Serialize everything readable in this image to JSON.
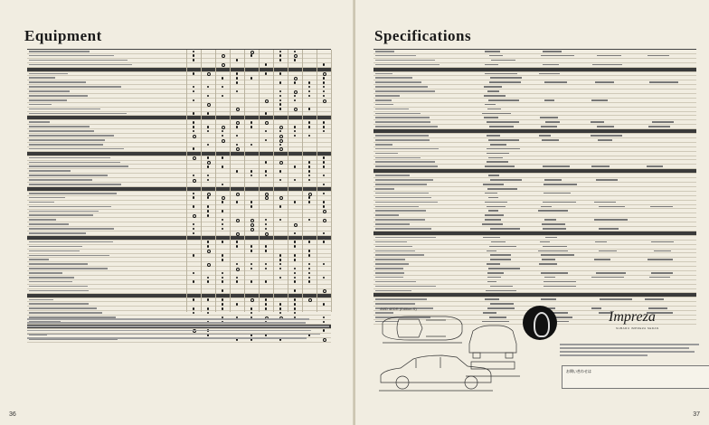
{
  "left_page": {
    "title": "Equipment",
    "page_number": "36"
  },
  "right_page": {
    "title": "Specifications",
    "page_number": "37",
    "drawing_caption": "4WD 4EDR (Edition-S)",
    "brand": "Impreza",
    "brand_subtitle": "SUBARU IMPREZA SEDAN",
    "dealer_label": "お問い合わせは"
  },
  "colors": {
    "paper": "#f1ede1",
    "ink": "#1a1a1a",
    "rule": "#cfc9b8"
  }
}
